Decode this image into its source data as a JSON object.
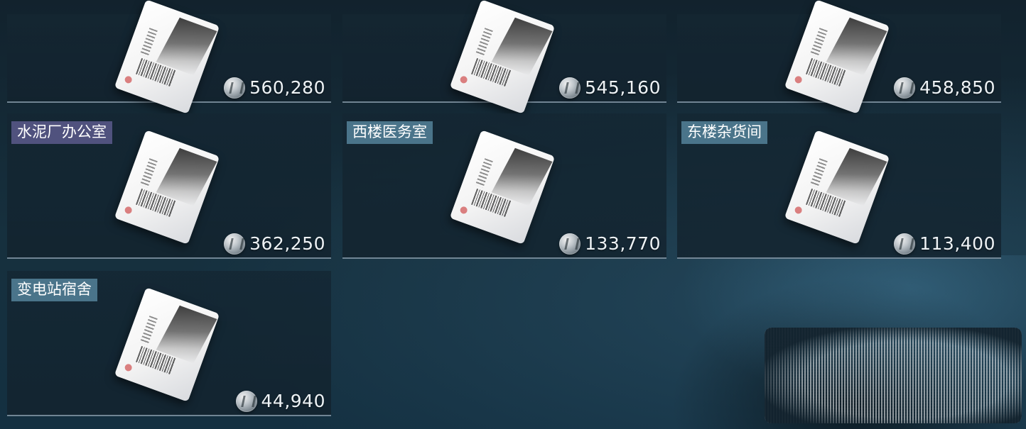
{
  "currency_icon": "silver-coin-icon",
  "tiles": [
    {
      "label": "",
      "price": "560,280"
    },
    {
      "label": "",
      "price": "545,160"
    },
    {
      "label": "",
      "price": "458,850"
    },
    {
      "label": "水泥厂办公室",
      "price": "362,250",
      "label_style": "purple"
    },
    {
      "label": "西楼医务室",
      "price": "133,770",
      "label_style": "teal"
    },
    {
      "label": "东楼杂货间",
      "price": "113,400",
      "label_style": "teal"
    },
    {
      "label": "变电站宿舍",
      "price": "44,940",
      "label_style": "teal"
    }
  ]
}
